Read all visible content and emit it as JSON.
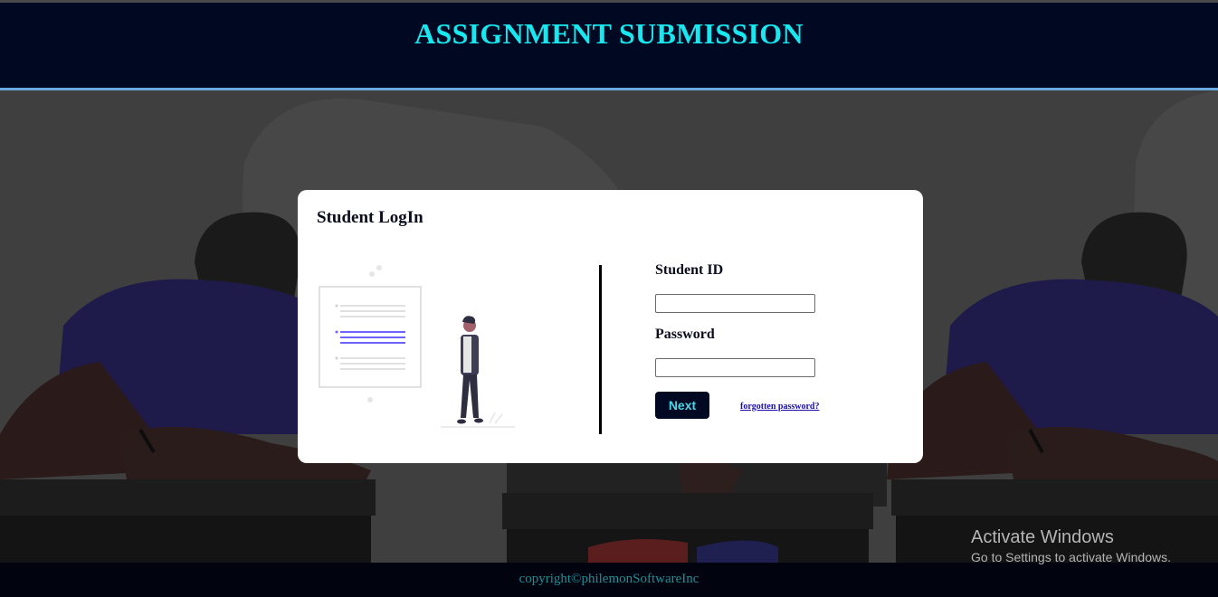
{
  "header": {
    "title": "ASSIGNMENT SUBMISSION"
  },
  "login_card": {
    "title": "Student LogIn",
    "student_id_label": "Student ID",
    "student_id_value": "",
    "password_label": "Password",
    "password_value": "",
    "next_button_label": "Next",
    "forgot_link_text": "forgotten password?"
  },
  "footer": {
    "copyright": "copyright©philemonSoftwareInc"
  },
  "os_watermark": {
    "line1": "Activate Windows",
    "line2": "Go to Settings to activate Windows."
  },
  "colors": {
    "header_bg": "#000822",
    "title_color": "#17e8f0",
    "accent_line": "#6aa8e0",
    "button_bg": "#000822",
    "button_text": "#49d6e6",
    "footer_text": "#1f8f96"
  }
}
